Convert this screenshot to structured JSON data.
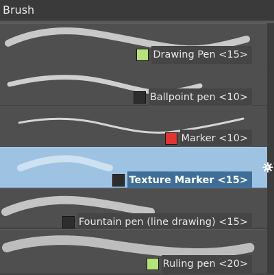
{
  "panel": {
    "title": "Brush"
  },
  "brushes": [
    {
      "label": "Drawing Pen <15>",
      "swatch": "#b5e27a",
      "selected": false
    },
    {
      "label": "Ballpoint pen <10>",
      "swatch": "#2d2d2d",
      "selected": false
    },
    {
      "label": "Marker <10>",
      "swatch": "#e23333",
      "selected": false
    },
    {
      "label": "Texture Marker <15>",
      "swatch": "#2d2d2d",
      "selected": true
    },
    {
      "label": "Fountain pen (line drawing) <15>",
      "swatch": "#2d2d2d",
      "selected": false
    },
    {
      "label": "Ruling pen <20>",
      "swatch": "#b5e27a",
      "selected": false
    }
  ],
  "colors": {
    "selection": "#9ec3e2",
    "panel_bg": "#4f4f4f"
  },
  "icons": {
    "selected_row": "gear-icon"
  }
}
